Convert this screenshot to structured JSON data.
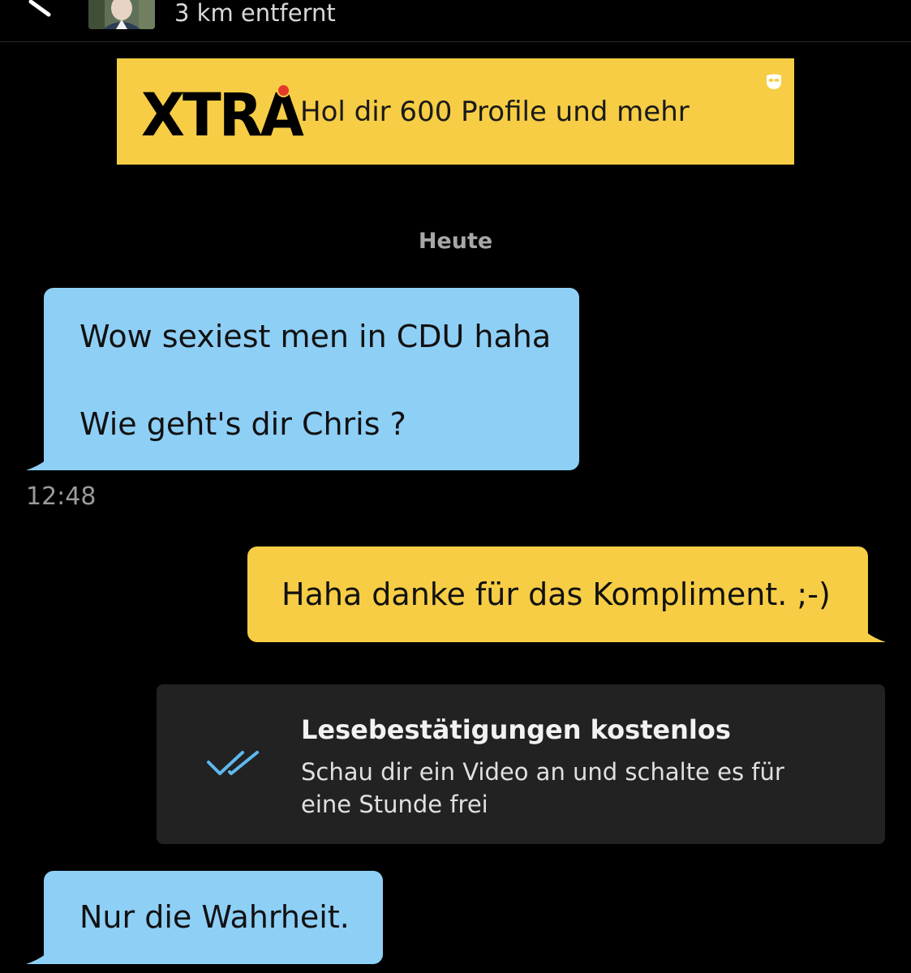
{
  "header": {
    "distance": "3 km entfernt"
  },
  "banner": {
    "logo": "XTRA",
    "text": "Hol dir 600 Profile und mehr"
  },
  "chat": {
    "date_separator": "Heute",
    "messages": [
      {
        "direction": "incoming",
        "lines": [
          "Wow sexiest men in CDU haha",
          "Wie geht's dir Chris ?"
        ],
        "time": "12:48"
      },
      {
        "direction": "outgoing",
        "lines": [
          "Haha danke für das Kompliment. ;-)"
        ]
      },
      {
        "direction": "incoming",
        "lines": [
          "Nur die Wahrheit."
        ]
      }
    ]
  },
  "read_receipts_promo": {
    "title": "Lesebestätigungen kostenlos",
    "description": "Schau dir ein Video an und schalte es für eine Stunde frei",
    "icon": "double-check-icon"
  },
  "colors": {
    "incoming_bubble": "#8ecff6",
    "outgoing_bubble": "#f6cd44",
    "background": "#000000",
    "card": "#222222",
    "check": "#5fb8ef"
  }
}
